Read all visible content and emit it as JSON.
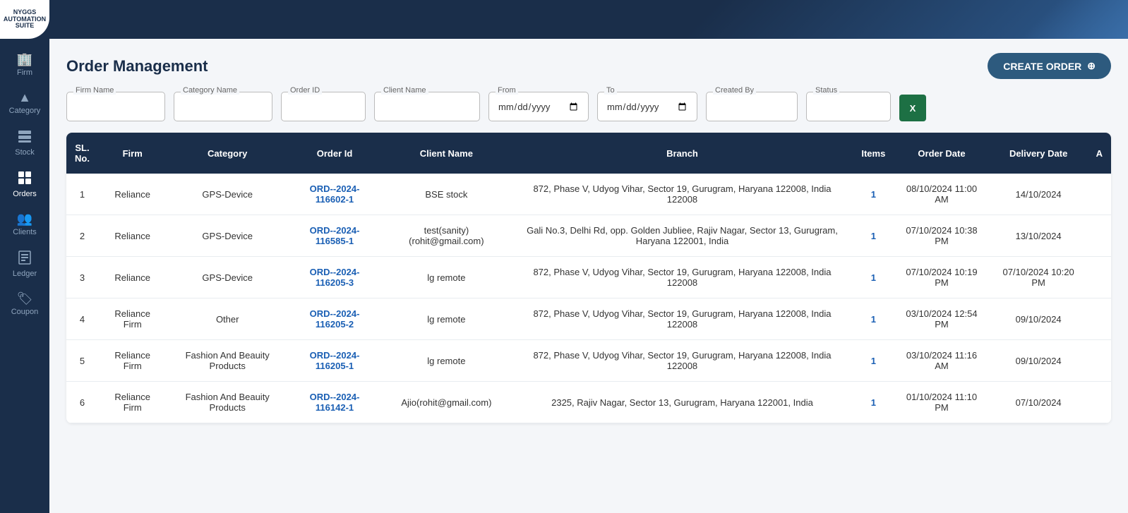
{
  "app": {
    "logo_line1": "NYGGS",
    "logo_line2": "AUTOMATION",
    "logo_line3": "SUITE"
  },
  "sidebar": {
    "items": [
      {
        "id": "firm",
        "label": "Firm",
        "icon": "🏢"
      },
      {
        "id": "category",
        "label": "Category",
        "icon": "▲"
      },
      {
        "id": "stock",
        "label": "Stock",
        "icon": "🗄"
      },
      {
        "id": "orders",
        "label": "Orders",
        "icon": "⊞",
        "active": true
      },
      {
        "id": "clients",
        "label": "Clients",
        "icon": "👥"
      },
      {
        "id": "ledger",
        "label": "Ledger",
        "icon": "📋"
      },
      {
        "id": "coupon",
        "label": "Coupon",
        "icon": "🏷"
      }
    ]
  },
  "page": {
    "title": "Order Management",
    "create_button": "CREATE ORDER"
  },
  "filters": {
    "firm_name_label": "Firm Name",
    "category_name_label": "Category Name",
    "order_id_label": "Order ID",
    "client_name_label": "Client Name",
    "from_label": "From",
    "to_label": "To",
    "created_by_label": "Created By",
    "status_label": "Status",
    "from_placeholder": "mm/dd/yyyy",
    "to_placeholder": "mm/dd/yyyy"
  },
  "table": {
    "headers": [
      "SL. No.",
      "Firm",
      "Category",
      "Order Id",
      "Client Name",
      "Branch",
      "Items",
      "Order Date",
      "Delivery Date",
      "A"
    ],
    "rows": [
      {
        "sl": "1",
        "firm": "Reliance",
        "category": "GPS-Device",
        "order_id": "ORD--2024-116602-1",
        "client_name": "BSE stock",
        "branch": "872, Phase V, Udyog Vihar, Sector 19, Gurugram, Haryana 122008, India 122008",
        "items": "1",
        "order_date": "08/10/2024\n11:00 AM",
        "delivery_date": "14/10/2024"
      },
      {
        "sl": "2",
        "firm": "Reliance",
        "category": "GPS-Device",
        "order_id": "ORD--2024-116585-1",
        "client_name": "test(sanity)(rohit@gmail.com)",
        "branch": "Gali No.3, Delhi Rd, opp. Golden Jubliee, Rajiv Nagar, Sector 13, Gurugram, Haryana 122001, India",
        "items": "1",
        "order_date": "07/10/2024\n10:38 PM",
        "delivery_date": "13/10/2024"
      },
      {
        "sl": "3",
        "firm": "Reliance",
        "category": "GPS-Device",
        "order_id": "ORD--2024-116205-3",
        "client_name": "lg remote",
        "branch": "872, Phase V, Udyog Vihar, Sector 19, Gurugram, Haryana 122008, India 122008",
        "items": "1",
        "order_date": "07/10/2024\n10:19 PM",
        "delivery_date": "07/10/2024\n10:20 PM"
      },
      {
        "sl": "4",
        "firm": "Reliance Firm",
        "category": "Other",
        "order_id": "ORD--2024-116205-2",
        "client_name": "lg remote",
        "branch": "872, Phase V, Udyog Vihar, Sector 19, Gurugram, Haryana 122008, India 122008",
        "items": "1",
        "order_date": "03/10/2024\n12:54 PM",
        "delivery_date": "09/10/2024"
      },
      {
        "sl": "5",
        "firm": "Reliance Firm",
        "category": "Fashion And Beauity Products",
        "order_id": "ORD--2024-116205-1",
        "client_name": "lg remote",
        "branch": "872, Phase V, Udyog Vihar, Sector 19, Gurugram, Haryana 122008, India 122008",
        "items": "1",
        "order_date": "03/10/2024\n11:16 AM",
        "delivery_date": "09/10/2024"
      },
      {
        "sl": "6",
        "firm": "Reliance Firm",
        "category": "Fashion And Beauity Products",
        "order_id": "ORD--2024-116142-1",
        "client_name": "Ajio(rohit@gmail.com)",
        "branch": "2325, Rajiv Nagar, Sector 13, Gurugram, Haryana 122001, India",
        "items": "1",
        "order_date": "01/10/2024\n11:10 PM",
        "delivery_date": "07/10/2024"
      }
    ]
  }
}
